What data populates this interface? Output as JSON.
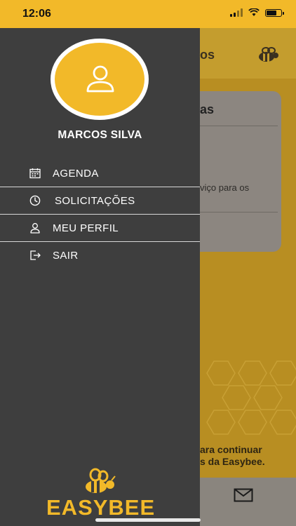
{
  "status_bar": {
    "time": "12:06"
  },
  "background": {
    "header_title": "os",
    "card_title": "as",
    "card_text": "viço para os",
    "footer_line1": "ara continuar",
    "footer_line2": "s da Easybee."
  },
  "drawer": {
    "user_name": "MARCOS SILVA",
    "menu": [
      {
        "label": "AGENDA",
        "icon": "calendar-icon"
      },
      {
        "label": "SOLICITAÇÕES",
        "icon": "clock-icon"
      },
      {
        "label": "MEU PERFIL",
        "icon": "user-icon"
      },
      {
        "label": "SAIR",
        "icon": "logout-icon"
      }
    ],
    "logo_text": "EASYBEE"
  },
  "colors": {
    "accent": "#f2b929",
    "drawer_bg": "#3e3e3e"
  }
}
